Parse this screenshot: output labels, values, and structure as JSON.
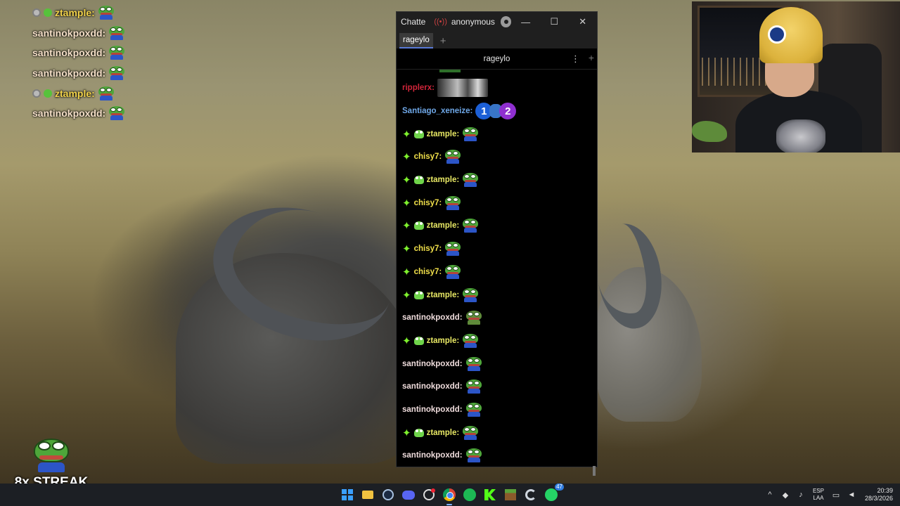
{
  "overlay_chat": [
    {
      "badge": "grey",
      "badge2": "green",
      "name": "ztample:",
      "color": "yellow"
    },
    {
      "badge": "",
      "badge2": "",
      "name": "santinokpoxdd:",
      "color": "pink"
    },
    {
      "badge": "",
      "badge2": "",
      "name": "santinokpoxdd:",
      "color": "pink"
    },
    {
      "badge": "",
      "badge2": "",
      "name": "santinokpoxdd:",
      "color": "pink"
    },
    {
      "badge": "grey",
      "badge2": "green",
      "name": "ztample:",
      "color": "yellow"
    },
    {
      "badge": "",
      "badge2": "",
      "name": "santinokpoxdd:",
      "color": "pink"
    }
  ],
  "streak": {
    "label": "8x STREAK"
  },
  "chat_window": {
    "app_title": "Chatte",
    "user": "anonymous",
    "live_icon": "((•))",
    "minimize": "—",
    "maximize": "☐",
    "close": "✕",
    "tab_label": "rageylo",
    "tab_add": "+",
    "split_title": "rageylo",
    "split_menu": "⋮",
    "split_add": "+"
  },
  "messages": [
    {
      "user": "ripplerx:",
      "cls": "c-ripple",
      "star": false,
      "frog": false,
      "emote": "gif"
    },
    {
      "user": "Santiago_xeneize:",
      "cls": "c-santiago",
      "star": false,
      "frog": false,
      "emote": "numbers"
    },
    {
      "user": "ztample:",
      "cls": "c-ztample",
      "star": true,
      "frog": true,
      "emote": "pepe"
    },
    {
      "user": "chisy7:",
      "cls": "c-chisy",
      "star": true,
      "frog": false,
      "emote": "pepe"
    },
    {
      "user": "ztample:",
      "cls": "c-ztample",
      "star": true,
      "frog": true,
      "emote": "pepe"
    },
    {
      "user": "chisy7:",
      "cls": "c-chisy",
      "star": true,
      "frog": false,
      "emote": "pepe"
    },
    {
      "user": "ztample:",
      "cls": "c-ztample",
      "star": true,
      "frog": true,
      "emote": "pepe"
    },
    {
      "user": "chisy7:",
      "cls": "c-chisy",
      "star": true,
      "frog": false,
      "emote": "pepe"
    },
    {
      "user": "chisy7:",
      "cls": "c-chisy",
      "star": true,
      "frog": false,
      "emote": "pepe"
    },
    {
      "user": "ztample:",
      "cls": "c-ztample",
      "star": true,
      "frog": true,
      "emote": "pepe"
    },
    {
      "user": "santinokpoxdd:",
      "cls": "c-santi",
      "star": false,
      "frog": false,
      "emote": "pepe-sad"
    },
    {
      "user": "ztample:",
      "cls": "c-ztample",
      "star": true,
      "frog": true,
      "emote": "pepe"
    },
    {
      "user": "santinokpoxdd:",
      "cls": "c-santi",
      "star": false,
      "frog": false,
      "emote": "pepe"
    },
    {
      "user": "santinokpoxdd:",
      "cls": "c-santi",
      "star": false,
      "frog": false,
      "emote": "pepe"
    },
    {
      "user": "santinokpoxdd:",
      "cls": "c-santi",
      "star": false,
      "frog": false,
      "emote": "pepe"
    },
    {
      "user": "ztample:",
      "cls": "c-ztample",
      "star": true,
      "frog": true,
      "emote": "pepe"
    },
    {
      "user": "santinokpoxdd:",
      "cls": "c-santi",
      "star": false,
      "frog": false,
      "emote": "pepe"
    }
  ],
  "number_emote": {
    "one": "1",
    "two": "2"
  },
  "taskbar": {
    "icons": [
      "start-icon",
      "file-explorer-icon",
      "steam-icon",
      "discord-icon",
      "wheel-icon",
      "chrome-icon",
      "spotify-icon",
      "kick-icon",
      "minecraft-icon",
      "c-app-icon",
      "whatsapp-icon"
    ],
    "whatsapp_badge": "47",
    "tray_up": "^",
    "lang_top": "ESP",
    "lang_bottom": "LAA",
    "time": "20:39",
    "date": "28/3/2026"
  }
}
